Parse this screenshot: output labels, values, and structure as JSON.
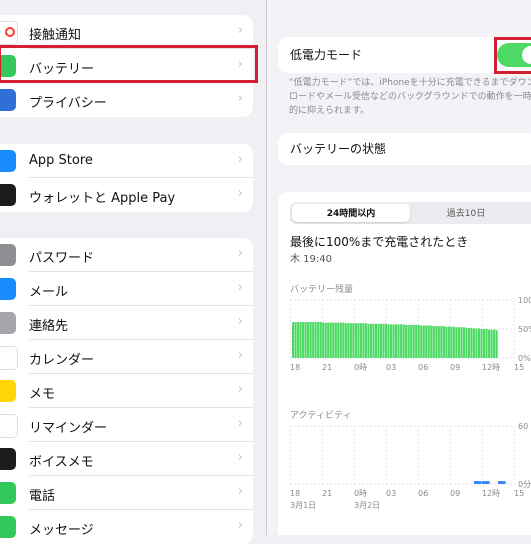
{
  "settings_list": {
    "group1": [
      {
        "label": "接触通知",
        "icon": "exposure-notification-icon",
        "color": "#ffffff",
        "accent": "#ff3b30"
      },
      {
        "label": "バッテリー",
        "icon": "battery-icon",
        "color": "#34c759"
      },
      {
        "label": "プライバシー",
        "icon": "hand-icon",
        "color": "#2f6fd6"
      }
    ],
    "group2": [
      {
        "label": "App Store",
        "icon": "app-store-icon",
        "color": "#1a8cff"
      },
      {
        "label": "ウォレットと Apple Pay",
        "icon": "wallet-icon",
        "color": "#1c1c1e"
      }
    ],
    "group3": [
      {
        "label": "パスワード",
        "icon": "key-icon",
        "color": "#8e8e93"
      },
      {
        "label": "メール",
        "icon": "mail-icon",
        "color": "#1a8cff"
      },
      {
        "label": "連絡先",
        "icon": "contacts-icon",
        "color": "#a6a6aa"
      },
      {
        "label": "カレンダー",
        "icon": "calendar-icon",
        "color": "#ffffff"
      },
      {
        "label": "メモ",
        "icon": "notes-icon",
        "color": "#ffd60a"
      },
      {
        "label": "リマインダー",
        "icon": "reminders-icon",
        "color": "#ffffff"
      },
      {
        "label": "ボイスメモ",
        "icon": "voice-memos-icon",
        "color": "#1c1c1e"
      },
      {
        "label": "電話",
        "icon": "phone-icon",
        "color": "#34c759"
      },
      {
        "label": "メッセージ",
        "icon": "messages-icon",
        "color": "#34c759"
      }
    ]
  },
  "battery_detail": {
    "low_power_label": "低電力モード",
    "low_power_on": true,
    "note": "“低電力モード”では、iPhoneを十分に充電できるまでダウンロードやメール受信などのバックグラウンドでの動作を一時的に抑えられます。",
    "battery_state_label": "バッテリーの状態",
    "tabs": [
      "24時間以内",
      "過去10日"
    ],
    "last_charged_title": "最後に100%まで充電されたとき",
    "last_charged_time": "木 19:40"
  },
  "chart_data": [
    {
      "type": "bar",
      "title": "バッテリー残量",
      "yticks": [
        "100",
        "50%",
        "0%"
      ],
      "x_ticks": [
        "18",
        "21",
        "0時",
        "03",
        "06",
        "09",
        "12時",
        "15"
      ],
      "values": [
        62,
        62,
        62,
        62,
        62,
        62,
        62,
        62,
        62,
        62,
        62,
        62,
        61,
        61,
        61,
        61,
        61,
        61,
        61,
        61,
        61,
        60,
        60,
        60,
        60,
        60,
        60,
        60,
        60,
        60,
        59,
        59,
        59,
        59,
        59,
        59,
        59,
        59,
        58,
        58,
        58,
        58,
        58,
        58,
        58,
        57,
        57,
        57,
        57,
        57,
        57,
        56,
        56,
        56,
        56,
        56,
        55,
        55,
        55,
        55,
        55,
        54,
        54,
        54,
        54,
        53,
        53,
        53,
        53,
        52,
        52,
        52,
        51,
        51,
        51,
        50,
        50,
        50,
        49,
        49,
        49,
        48
      ],
      "ylim": [
        0,
        100
      ]
    },
    {
      "type": "bar",
      "title": "アクティビティ",
      "yticks": [
        "60",
        "0分"
      ],
      "x_ticks": [
        "18",
        "21",
        "0時",
        "03",
        "06",
        "09",
        "12時",
        "15"
      ],
      "x_dates": [
        "3月1日",
        "3月2日"
      ],
      "values": [
        0,
        0,
        0,
        0,
        0,
        0,
        0,
        0,
        0,
        0,
        0,
        0,
        0,
        0,
        0,
        0,
        0,
        0,
        0,
        0,
        0,
        0,
        0,
        3,
        3,
        0,
        3,
        0
      ],
      "ylim": [
        0,
        60
      ]
    }
  ]
}
